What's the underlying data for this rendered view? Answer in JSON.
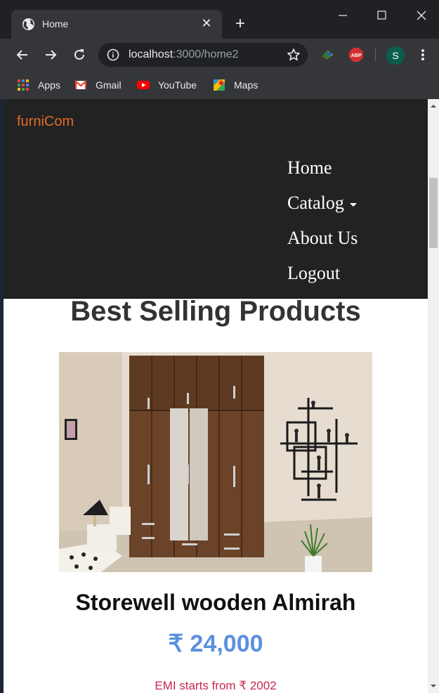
{
  "browser": {
    "tab_title": "Home",
    "tab_close": "✕",
    "new_tab": "+",
    "url_host": "localhost",
    "url_path": ":3000/home2",
    "profile_initial": "S",
    "abp_label": "ABP",
    "bookmarks": [
      {
        "label": "Apps",
        "icon": "apps-grid-icon"
      },
      {
        "label": "Gmail",
        "icon": "gmail-icon"
      },
      {
        "label": "YouTube",
        "icon": "youtube-icon"
      },
      {
        "label": "Maps",
        "icon": "maps-icon"
      }
    ]
  },
  "site": {
    "brand": "furniCom",
    "nav": {
      "home": "Home",
      "catalog": "Catalog",
      "about": "About Us",
      "logout": "Logout"
    }
  },
  "main": {
    "heading": "Best Selling Products",
    "product": {
      "name": "Storewell wooden Almirah",
      "price": "₹ 24,000",
      "emi": "EMI starts from ₹ 2002"
    }
  },
  "colors": {
    "brand": "#e06a24",
    "price": "#5b8fdf",
    "emi": "#c7254e",
    "navbar": "#222222"
  }
}
